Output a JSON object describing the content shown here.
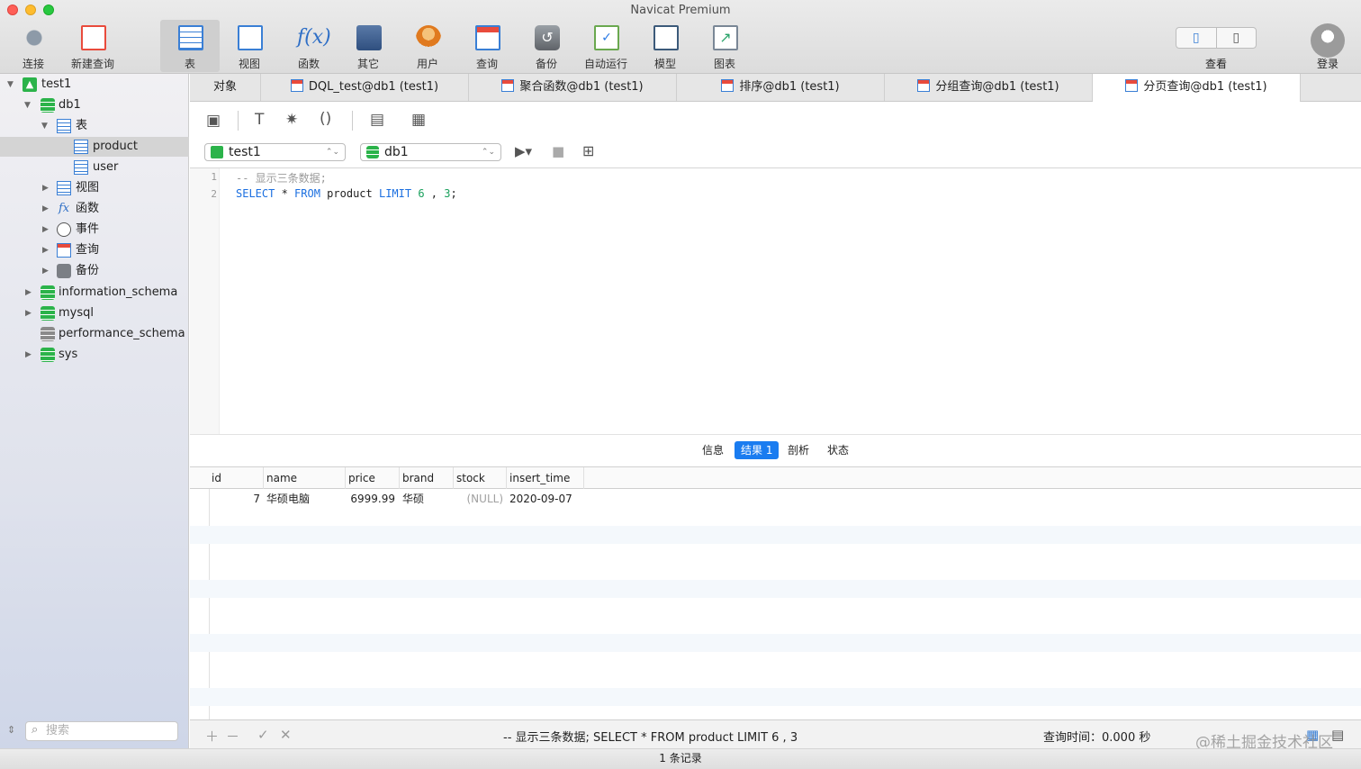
{
  "window": {
    "title": "Navicat Premium"
  },
  "toolbar": {
    "items": [
      {
        "label": "连接",
        "icon": "connection-icon"
      },
      {
        "label": "新建查询",
        "icon": "new-query-icon"
      },
      {
        "label": "表",
        "icon": "table-icon"
      },
      {
        "label": "视图",
        "icon": "view-icon"
      },
      {
        "label": "函数",
        "icon": "function-icon"
      },
      {
        "label": "其它",
        "icon": "tools-icon"
      },
      {
        "label": "用户",
        "icon": "user-icon"
      },
      {
        "label": "查询",
        "icon": "query-icon"
      },
      {
        "label": "备份",
        "icon": "backup-icon"
      },
      {
        "label": "自动运行",
        "icon": "automation-icon"
      },
      {
        "label": "模型",
        "icon": "model-icon"
      },
      {
        "label": "图表",
        "icon": "chart-icon"
      }
    ],
    "view_label": "查看",
    "login_label": "登录"
  },
  "sidebar": {
    "tree": [
      {
        "label": "test1"
      },
      {
        "label": "db1"
      },
      {
        "label": "表"
      },
      {
        "label": "product"
      },
      {
        "label": "user"
      },
      {
        "label": "视图"
      },
      {
        "label": "函数"
      },
      {
        "label": "事件"
      },
      {
        "label": "查询"
      },
      {
        "label": "备份"
      },
      {
        "label": "information_schema"
      },
      {
        "label": "mysql"
      },
      {
        "label": "performance_schema"
      },
      {
        "label": "sys"
      }
    ],
    "search_placeholder": "搜索"
  },
  "tabs": [
    {
      "label": "对象"
    },
    {
      "label": "DQL_test@db1 (test1)"
    },
    {
      "label": "聚合函数@db1 (test1)"
    },
    {
      "label": "排序@db1 (test1)"
    },
    {
      "label": "分组查询@db1 (test1)"
    },
    {
      "label": "分页查询@db1 (test1)"
    }
  ],
  "editor": {
    "connection": "test1",
    "database": "db1",
    "lines": [
      {
        "no": "1",
        "comment": "-- 显示三条数据;"
      },
      {
        "no": "2",
        "kw1": "SELECT",
        "star": " * ",
        "kw2": "FROM",
        "table": " product ",
        "kw3": "LIMIT",
        "n1": " 6 ",
        "comma": ",",
        "n2": " 3",
        "end": ";"
      }
    ]
  },
  "result_tabs": [
    {
      "label": "信息"
    },
    {
      "label": "结果 1"
    },
    {
      "label": "剖析"
    },
    {
      "label": "状态"
    }
  ],
  "grid": {
    "columns": [
      "id",
      "name",
      "price",
      "brand",
      "stock",
      "insert_time"
    ],
    "rows": [
      {
        "id": "7",
        "name": "华硕电脑",
        "price": "6999.99",
        "brand": "华硕",
        "stock": "(NULL)",
        "insert_time": "2020-09-07"
      }
    ]
  },
  "status": {
    "sql": "-- 显示三条数据; SELECT * FROM product LIMIT 6 , 3",
    "query_time": "查询时间：0.000 秒",
    "record_count": "1 条记录"
  },
  "watermark": "@稀土掘金技术社区"
}
